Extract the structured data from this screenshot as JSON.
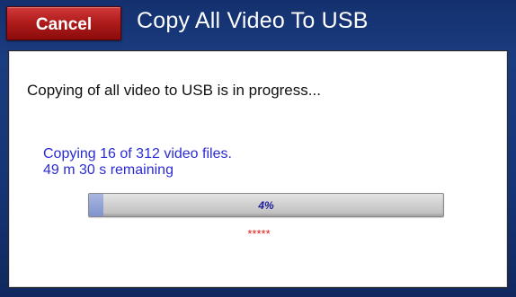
{
  "header": {
    "cancel_label": "Cancel",
    "title": "Copy All Video To USB"
  },
  "dialog": {
    "status_message": "Copying of all video to USB is in progress...",
    "files_progress_text": "Copying 16 of 312 video files.",
    "time_remaining_text": "49 m 30 s remaining",
    "progress": {
      "percent_value": 4,
      "percent_label": "4%"
    },
    "activity_indicator": "*****"
  },
  "colors": {
    "background_blue": "#163577",
    "cancel_red": "#b01c1c",
    "detail_text_blue": "#2b2bd6",
    "indicator_red": "#e01818"
  }
}
